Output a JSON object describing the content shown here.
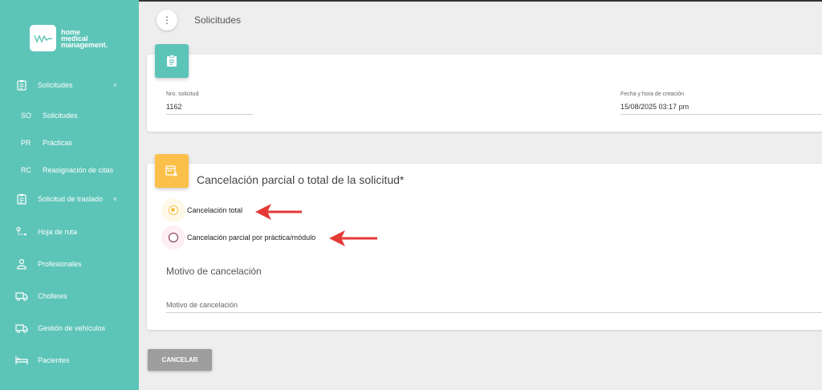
{
  "brand": {
    "line1": "home",
    "line2": "medical",
    "line3": "management."
  },
  "sidebar": {
    "items": [
      {
        "label": "Solicitudes",
        "caret": "˄"
      },
      {
        "label": "Solicitud de traslado",
        "caret": "˅"
      },
      {
        "label": "Hoja de ruta"
      },
      {
        "label": "Profesionales"
      },
      {
        "label": "Choferes"
      },
      {
        "label": "Gestión de vehículos"
      },
      {
        "label": "Pacientes"
      }
    ],
    "subitems": [
      {
        "abbr": "SO",
        "label": "Solicitudes"
      },
      {
        "abbr": "PR",
        "label": "Prácticas"
      },
      {
        "abbr": "RC",
        "label": "Reasignación de citas"
      }
    ]
  },
  "header": {
    "menu_icon": "⋮",
    "title": "Solicitudes"
  },
  "request": {
    "number_label": "Nro. solicitud",
    "number_value": "1162",
    "date_label": "Fecha y hora de creación",
    "date_value": "15/08/2025 03:17 pm"
  },
  "cancellation": {
    "title": "Cancelación parcial o total de la solicitud*",
    "options": [
      {
        "label": "Cancelación total",
        "selected": true
      },
      {
        "label": "Cancelación parcial por práctica/módulo",
        "selected": false
      }
    ],
    "reason_heading": "Motivo de cancelación",
    "reason_placeholder": "Motivo de cancelación",
    "reason_value": ""
  },
  "actions": {
    "cancel_label": "CANCELAR"
  },
  "colors": {
    "sidebar": "#5dc4b8",
    "accent_yellow": "#fbc04a",
    "arrow_red": "#e53935",
    "radio_selected": "#f5c242"
  }
}
